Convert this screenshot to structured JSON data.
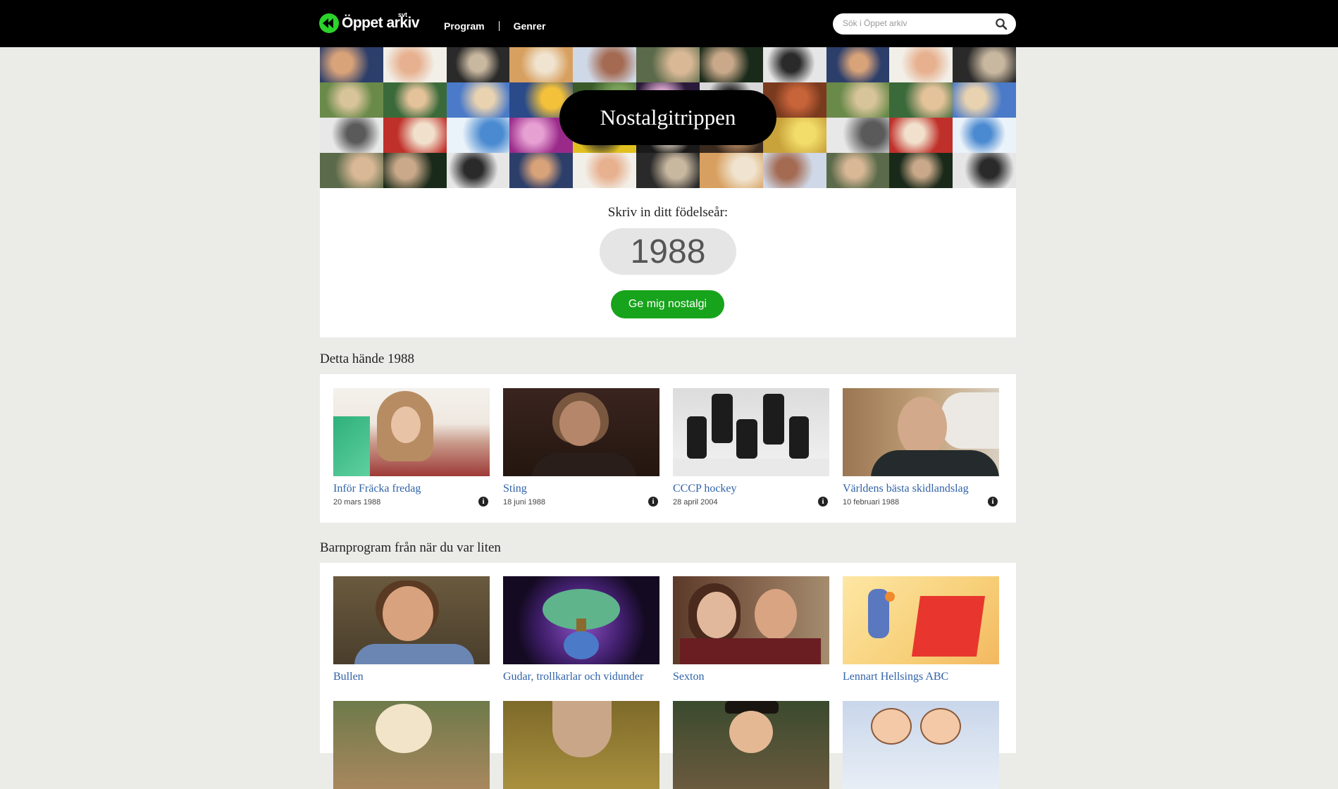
{
  "header": {
    "logo_text": "Öppet arkiv",
    "logo_svt": "svt",
    "nav": [
      {
        "label": "Program"
      },
      {
        "label": "Genrer"
      }
    ],
    "search_placeholder": "Sök i Öppet arkiv"
  },
  "hero": {
    "title": "Nostalgitrippen"
  },
  "birth_year": {
    "label": "Skriv in ditt födelseår:",
    "value": "1988",
    "button_label": "Ge mig nostalgi"
  },
  "happened": {
    "title": "Detta hände 1988",
    "items": [
      {
        "title": "Inför Fräcka fredag",
        "date": "20 mars 1988",
        "icon": "info-icon"
      },
      {
        "title": "Sting",
        "date": "18 juni 1988",
        "icon": "info-icon"
      },
      {
        "title": "CCCP hockey",
        "date": "28 april 2004",
        "icon": "info-icon"
      },
      {
        "title": "Världens bästa skidlandslag",
        "date": "10 februari 1988",
        "icon": "info-icon"
      }
    ]
  },
  "kids": {
    "title": "Barnprogram från när du var liten",
    "items": [
      {
        "title": "Bullen"
      },
      {
        "title": "Gudar, trollkarlar och vidunder"
      },
      {
        "title": "Sexton"
      },
      {
        "title": "Lennart Hellsings ABC"
      }
    ]
  },
  "colors": {
    "accent_green": "#17a31b",
    "link_blue": "#2f62a8",
    "topbar": "#000000",
    "background": "#ebebe8"
  }
}
